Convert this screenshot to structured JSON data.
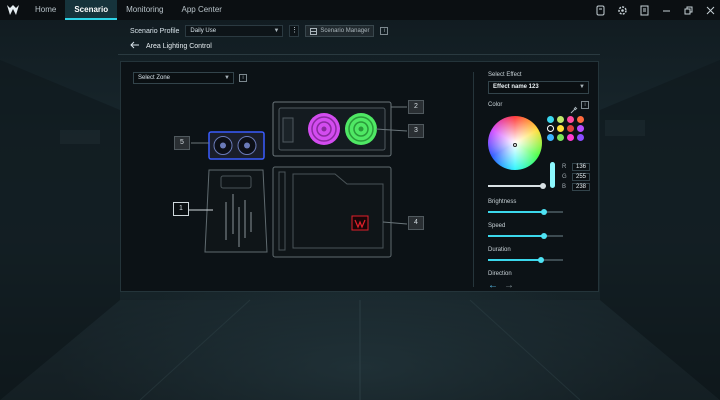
{
  "nav": {
    "tabs": [
      {
        "label": "Home"
      },
      {
        "label": "Scenario"
      },
      {
        "label": "Monitoring"
      },
      {
        "label": "App Center"
      }
    ]
  },
  "profile": {
    "label": "Scenario Profile",
    "selected": "Daily Use",
    "manager_label": "Scenario Manager"
  },
  "breadcrumb": {
    "title": "Area Lighting Control"
  },
  "zone": {
    "placeholder": "Select Zone",
    "callouts": [
      "1",
      "2",
      "3",
      "4",
      "5"
    ],
    "fan_color": "#d34cf0",
    "fan_color_2": "#4fe864",
    "gpu_light_color": "#3a5cff",
    "logo_color": "#e0202a"
  },
  "effect": {
    "section_label": "Select Effect",
    "selected": "Effect name 123",
    "color_label": "Color",
    "swatches": [
      "#3bd6ec",
      "#bfe86a",
      "#ff4ba0",
      "#ff6a3d",
      "#ring",
      "#ffde3a",
      "#e04040",
      "#b84cff",
      "#3bb5ff",
      "#7ae55a",
      "#ff3bd0",
      "#8a4cff"
    ],
    "rgb": {
      "r": "136",
      "g": "255",
      "b": "238"
    },
    "brightness": {
      "label": "Brightness",
      "value": 0.74
    },
    "speed": {
      "label": "Speed",
      "value": 0.74
    },
    "duration": {
      "label": "Duration",
      "value": 0.71
    },
    "direction_label": "Direction",
    "accent": "#3bd8ec"
  }
}
